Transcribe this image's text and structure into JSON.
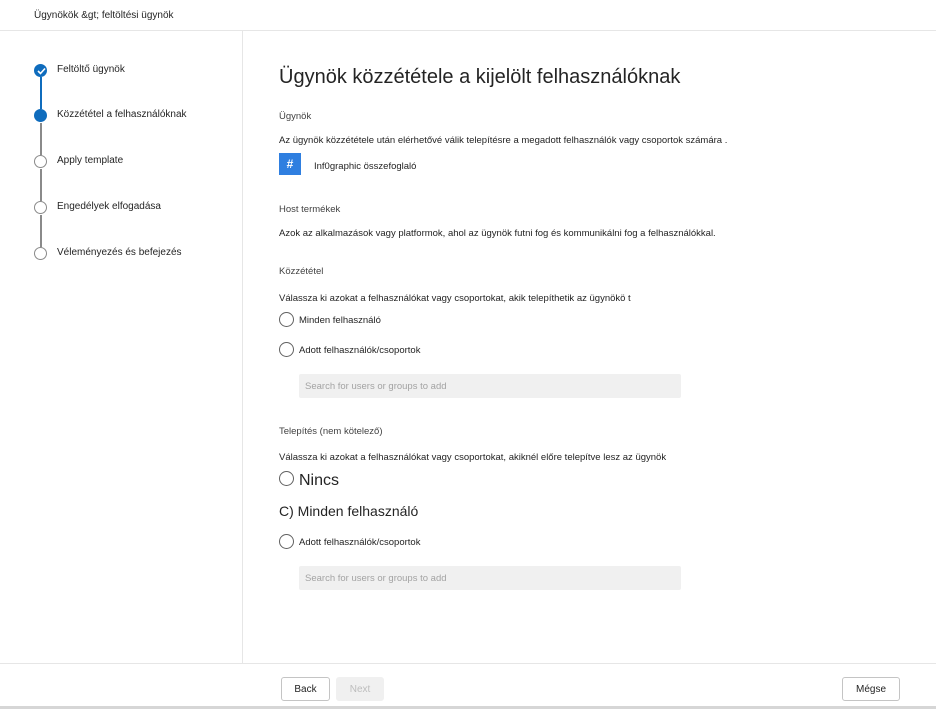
{
  "header": {
    "breadcrumb": "Ügynökök &gt; feltöltési ügynök"
  },
  "steps": [
    {
      "label": "Feltöltő ügynök",
      "state": "done"
    },
    {
      "label": "Közzététel a felhasználóknak",
      "state": "current"
    },
    {
      "label": "Apply template",
      "state": "pending"
    },
    {
      "label": "Engedélyek elfogadása",
      "state": "pending"
    },
    {
      "label": "Véleményezés és befejezés",
      "state": "pending"
    }
  ],
  "main": {
    "title": "Ügynök közzététele a kijelölt felhasználóknak",
    "agents_section": {
      "heading": "Ügynök",
      "description": "Az ügynök közzététele után elérhetővé válik telepítésre a megadott felhasználók vagy csoportok számára .",
      "agent": {
        "icon_glyph": "#",
        "icon_color": "#2f7fe0",
        "name": "Inf0graphic összefoglaló"
      }
    },
    "host_section": {
      "heading": "Host termékek",
      "description": "Azok az alkalmazások vagy platformok, ahol az ügynök futni fog és kommunikálni fog a felhasználókkal."
    },
    "publish_section": {
      "heading": "Közzététel",
      "description": "Válassza ki azokat a felhasználókat vagy csoportokat, akik telepíthetik az ügynökö t",
      "options": [
        "Minden felhasználó",
        "Adott felhasználók/csoportok"
      ],
      "search_placeholder": "Search for users or groups to add"
    },
    "install_section": {
      "heading": "Telepítés (nem kötelező)",
      "description": "Válassza ki azokat a felhasználókat vagy csoportokat, akiknél előre telepítve lesz az ügynök",
      "option_none": "Nincs",
      "option_all": "C) Minden felhasználó",
      "option_specific": "Adott felhasználók/csoportok",
      "search_placeholder": "Search for users or groups to add"
    }
  },
  "footer": {
    "back_label": "Back",
    "next_label": "Next",
    "cancel_label": "Mégse"
  },
  "colors": {
    "accent": "#0f6cbd",
    "pending": "#8a8a8a"
  }
}
